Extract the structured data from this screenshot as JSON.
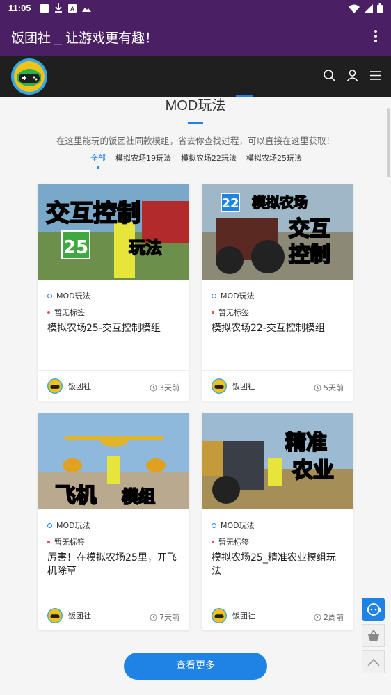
{
  "status_bar": {
    "time": "11:05",
    "left_icons": [
      "notification-square-icon",
      "download-icon",
      "a-icon",
      "image-icon"
    ],
    "right_icons": [
      "wifi-icon",
      "signal-icon",
      "battery-icon"
    ]
  },
  "app_bar": {
    "title": "饭团社 _ 让游戏更有趣！",
    "menu_icon": "more-vertical-icon"
  },
  "site_header": {
    "logo_icon": "gamepad-logo-icon",
    "icons": [
      "search-icon",
      "user-icon",
      "menu-icon"
    ]
  },
  "section": {
    "title": "MOD玩法",
    "description": "在这里能玩的饭团社同款模组，省去你查找过程，可以直接在这里获取！",
    "tabs": [
      {
        "label": "全部",
        "active": true
      },
      {
        "label": "模拟农场19玩法",
        "active": false
      },
      {
        "label": "模拟农场22玩法",
        "active": false
      },
      {
        "label": "模拟农场25玩法",
        "active": false
      }
    ]
  },
  "cards": [
    {
      "thumb_text": [
        "交互控制",
        "25",
        "玩法"
      ],
      "category": "MOD玩法",
      "tag": "暂无标签",
      "title": "模拟农场25-交互控制模组",
      "author": "饭团社",
      "time": "3天前"
    },
    {
      "thumb_text": [
        "22",
        "模拟农场",
        "交互",
        "控制"
      ],
      "category": "MOD玩法",
      "tag": "暂无标签",
      "title": "模拟农场22-交互控制模组",
      "author": "饭团社",
      "time": "5天前"
    },
    {
      "thumb_text": [
        "飞机",
        "模组"
      ],
      "category": "MOD玩法",
      "tag": "暂无标签",
      "title": "厉害！在模拟农场25里，开飞机除草",
      "author": "饭团社",
      "time": "7天前"
    },
    {
      "thumb_text": [
        "精准",
        "农业"
      ],
      "category": "MOD玩法",
      "tag": "暂无标签",
      "title": "模拟农场25_精准农业模组玩法",
      "author": "饭团社",
      "time": "2周前"
    }
  ],
  "more_button": "查看更多",
  "floating": {
    "icons": [
      "customer-service-icon",
      "shopping-basket-icon",
      "back-to-top-icon"
    ]
  },
  "colors": {
    "app_bar": "#4a1f63",
    "site_header": "#1f1f1f",
    "accent": "#1f83e5",
    "tag_dot": "#e0524f"
  }
}
